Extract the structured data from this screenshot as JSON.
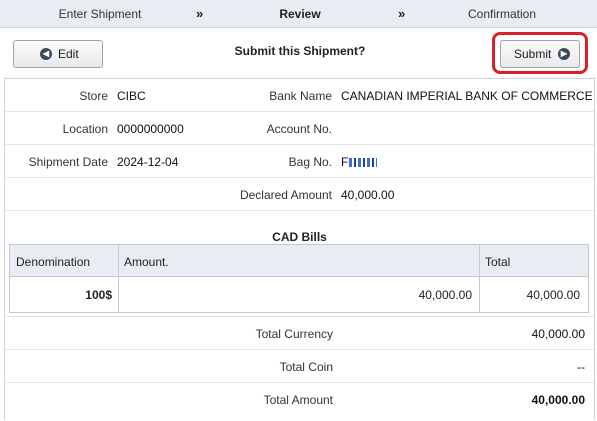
{
  "steps": {
    "step1": "Enter Shipment",
    "step2": "Review",
    "step3": "Confirmation",
    "separator": "»"
  },
  "actions": {
    "edit_label": "Edit",
    "prompt": "Submit this Shipment?",
    "submit_label": "Submit"
  },
  "details": {
    "store_label": "Store",
    "store_value": "CIBC",
    "bank_name_label": "Bank Name",
    "bank_name_value": "CANADIAN IMPERIAL BANK OF COMMERCE",
    "location_label": "Location",
    "location_value": "0000000000",
    "account_no_label": "Account No.",
    "account_no_value": "",
    "shipment_date_label": "Shipment Date",
    "shipment_date_value": "2024-12-04",
    "bag_no_label": "Bag No.",
    "bag_no_value": "F",
    "declared_amount_label": "Declared Amount",
    "declared_amount_value": "40,000.00"
  },
  "bills": {
    "title": "CAD Bills",
    "columns": [
      "Denomination",
      "Amount.",
      "Total"
    ],
    "rows": [
      {
        "denomination": "100$",
        "amount": "40,000.00",
        "total": "40,000.00"
      }
    ]
  },
  "totals": {
    "currency_label": "Total Currency",
    "currency_value": "40,000.00",
    "coin_label": "Total Coin",
    "coin_value": "--",
    "amount_label": "Total Amount",
    "amount_value": "40,000.00"
  },
  "colors": {
    "highlight": "#d9212b",
    "header_bg": "#e9ecf2",
    "icon": "#3d4a5c"
  }
}
